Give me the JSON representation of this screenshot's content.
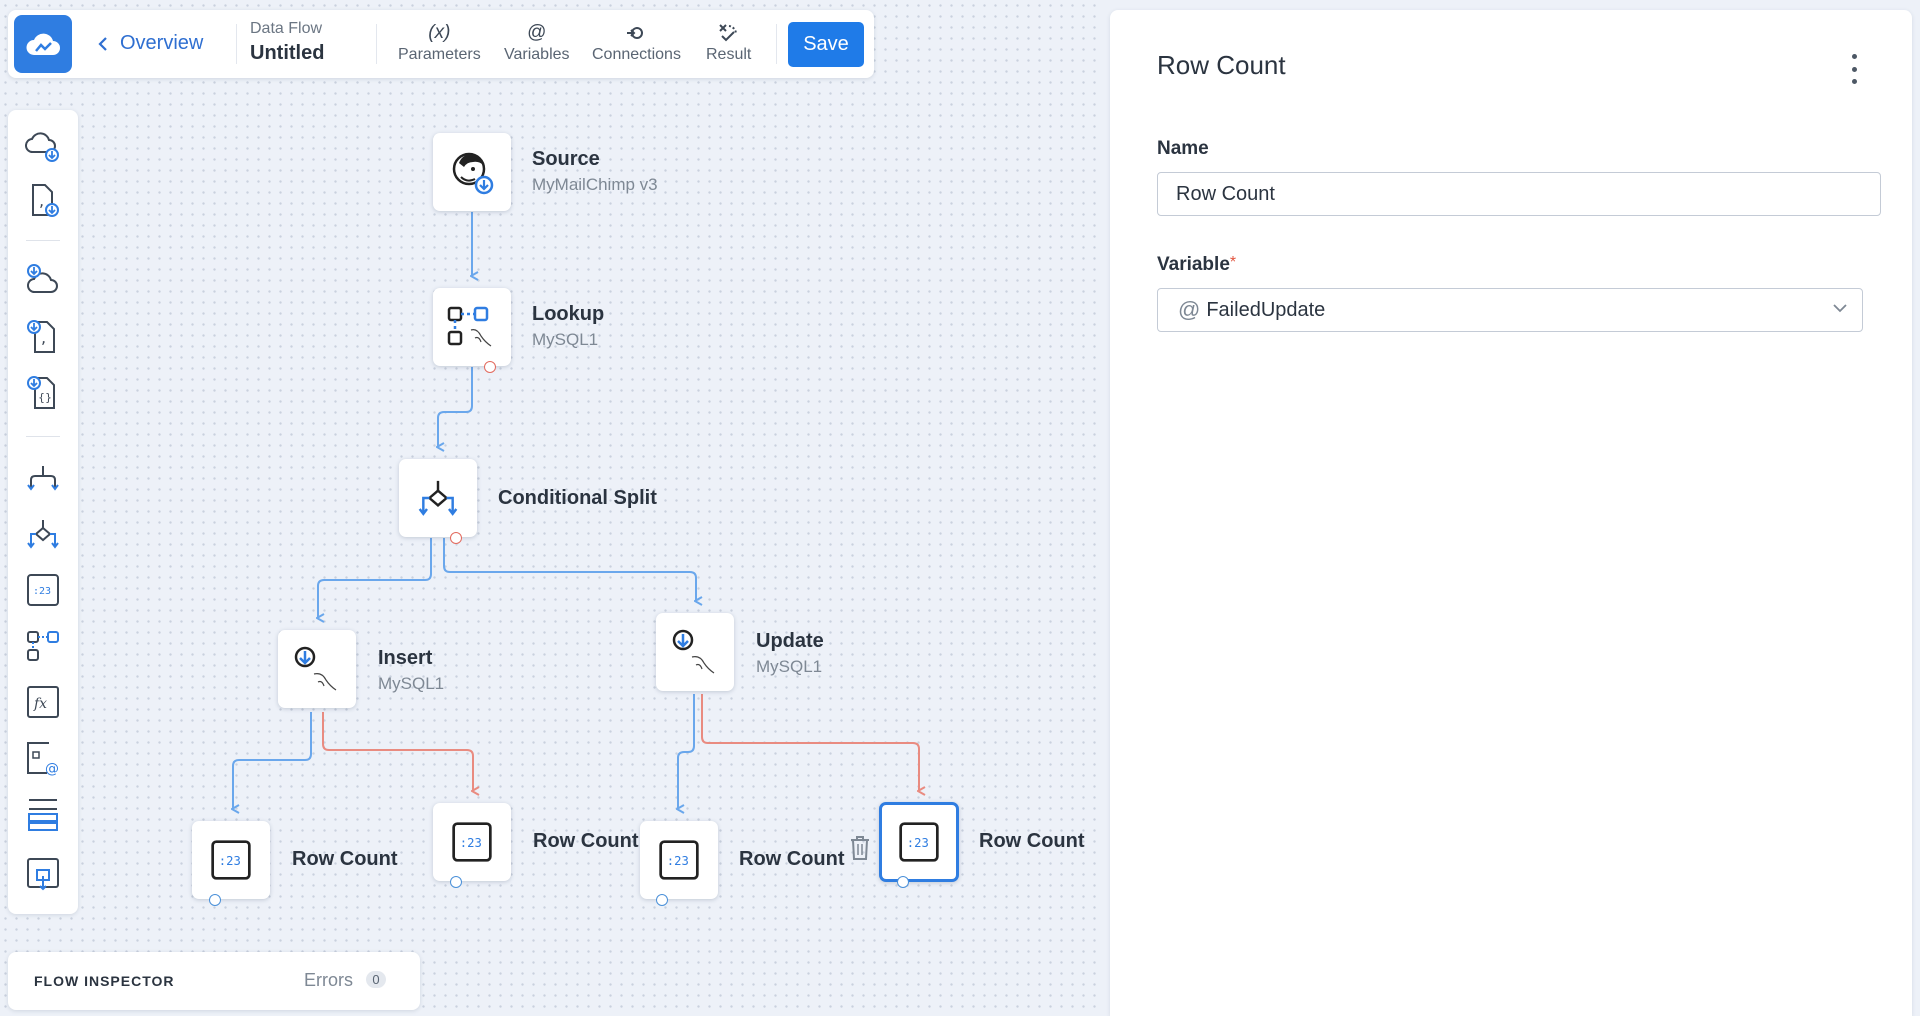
{
  "toolbar": {
    "back_label": "Overview",
    "doc_kind": "Data Flow",
    "doc_name": "Untitled",
    "buttons": [
      {
        "icon": "(x)",
        "label": "Parameters"
      },
      {
        "icon": "@",
        "label": "Variables"
      },
      {
        "icon": "connection-icon",
        "label": "Connections"
      },
      {
        "icon": "result-icon",
        "label": "Result"
      }
    ],
    "save_label": "Save"
  },
  "palette": {
    "items": [
      "cloud-source-icon",
      "file-source-icon",
      "cloud-target-icon",
      "file-target-icon",
      "json-target-icon",
      "split-icon",
      "conditional-split-icon",
      "row-count-icon",
      "lookup-icon",
      "expression-icon",
      "assign-variable-icon",
      "union-icon",
      "buffer-icon"
    ]
  },
  "nodes": {
    "source": {
      "label": "Source",
      "sub": "MyMailChimp v3"
    },
    "lookup": {
      "label": "Lookup",
      "sub": "MySQL1"
    },
    "split": {
      "label": "Conditional Split"
    },
    "insert": {
      "label": "Insert",
      "sub": "MySQL1"
    },
    "update": {
      "label": "Update",
      "sub": "MySQL1"
    },
    "rc1": {
      "label": "Row Count"
    },
    "rc2": {
      "label": "Row Count"
    },
    "rc3": {
      "label": "Row Count"
    },
    "rc4": {
      "label": "Row Count"
    }
  },
  "inspector": {
    "title": "FLOW INSPECTOR",
    "errors_label": "Errors",
    "errors_count": "0"
  },
  "panel": {
    "title": "Row Count",
    "name_label": "Name",
    "name_value": "Row Count",
    "variable_label": "Variable",
    "variable_required": "*",
    "variable_prefix": "@",
    "variable_value": "FailedUpdate"
  },
  "colors": {
    "accent": "#1f7be8",
    "success_link": "#6aa7ec",
    "error_link": "#e98b80"
  }
}
